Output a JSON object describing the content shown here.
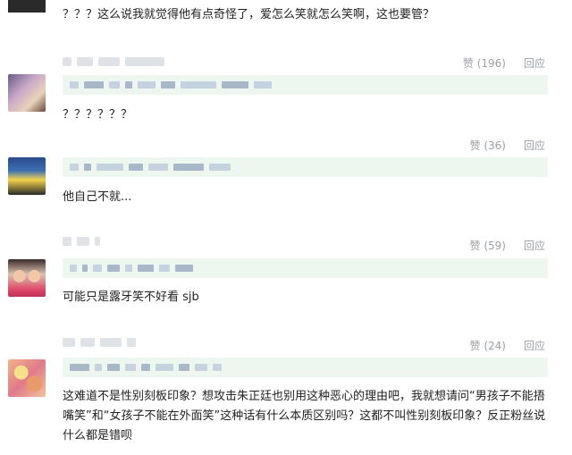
{
  "comments": [
    {
      "text": "？？？这么说我就觉得他有点奇怪了，爱怎么笑就怎么笑啊，这也要管？"
    },
    {
      "like": "赞 (196)",
      "reply": "回应",
      "text": "？？？？？？"
    },
    {
      "like": "赞 (36)",
      "reply": "回应",
      "text": "他自己不就..."
    },
    {
      "like": "赞 (59)",
      "reply": "回应",
      "text": "可能只是露牙笑不好看 sjb"
    },
    {
      "like": "赞 (24)",
      "reply": "回应",
      "text": "这难道不是性别刻板印象？想攻击朱正廷也别用这种恶心的理由吧，我就想请问“男孩子不能捂嘴笑”和“女孩子不能在外面笑”这种话有什么本质区别吗？这都不叫性别刻板印象？反正粉丝说什么都是错呗"
    }
  ],
  "colors": {
    "meta": "#9aa0a6",
    "quote_bg": "#eef6f0",
    "text": "#222222"
  }
}
